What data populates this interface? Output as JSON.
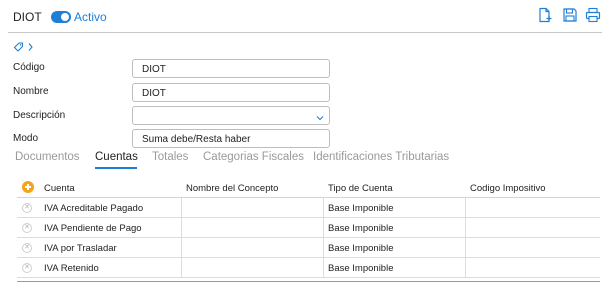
{
  "header": {
    "title": "DIOT",
    "status_label": "Activo",
    "toggle_on": true,
    "accent_color": "#1e7fd6",
    "tools": [
      "new-document-icon",
      "save-icon",
      "print-icon"
    ]
  },
  "form": {
    "codigo": {
      "label": "Código",
      "value": "DIOT"
    },
    "nombre": {
      "label": "Nombre",
      "value": "DIOT"
    },
    "descripcion": {
      "label": "Descripción",
      "value": ""
    },
    "modo": {
      "label": "Modo",
      "value": "Suma debe/Resta haber"
    }
  },
  "tabs": [
    {
      "label": "Documentos",
      "active": false
    },
    {
      "label": "Cuentas",
      "active": true
    },
    {
      "label": "Totales",
      "active": false
    },
    {
      "label": "Categorias Fiscales",
      "active": false
    },
    {
      "label": "Identificaciones Tributarias",
      "active": false
    }
  ],
  "grid": {
    "columns": [
      "Cuenta",
      "Nombre del Concepto",
      "Tipo de Cuenta",
      "Codigo Impositivo"
    ],
    "rows": [
      {
        "cuenta": "IVA Acreditable Pagado",
        "concepto": "",
        "tipo": "Base Imponible",
        "codigo": ""
      },
      {
        "cuenta": "IVA Pendiente de Pago",
        "concepto": "",
        "tipo": "Base Imponible",
        "codigo": ""
      },
      {
        "cuenta": "IVA por Trasladar",
        "concepto": "",
        "tipo": "Base Imponible",
        "codigo": ""
      },
      {
        "cuenta": "IVA Retenido",
        "concepto": "",
        "tipo": "Base Imponible",
        "codigo": ""
      }
    ]
  }
}
